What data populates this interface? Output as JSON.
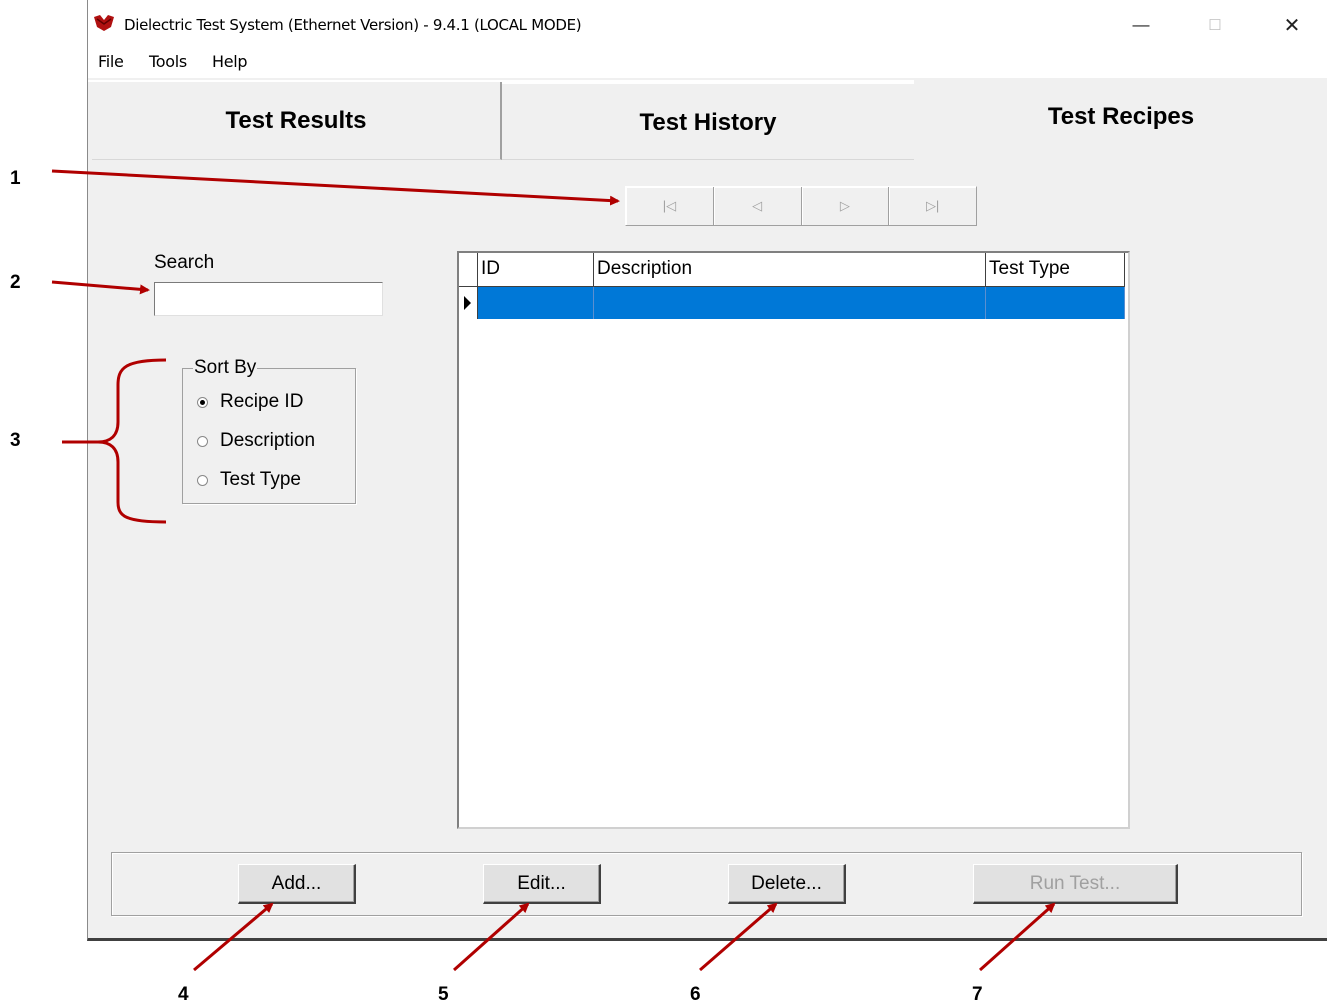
{
  "window": {
    "title": "Dielectric Test System (Ethernet Version) - 9.4.1  (LOCAL MODE)",
    "controls": {
      "minimize": "—",
      "maximize": "☐",
      "close": "✕"
    }
  },
  "menu": {
    "file": "File",
    "tools": "Tools",
    "help": "Help"
  },
  "tabs": [
    {
      "label": "Test Results"
    },
    {
      "label": "Test History"
    },
    {
      "label": "Test Recipes"
    }
  ],
  "nav_buttons": {
    "first": "|◁",
    "prev": "◁",
    "next": "▷",
    "last": "▷|"
  },
  "search": {
    "label": "Search",
    "value": ""
  },
  "sort": {
    "legend": "Sort By",
    "options": [
      {
        "label": "Recipe ID",
        "selected": true
      },
      {
        "label": "Description",
        "selected": false
      },
      {
        "label": "Test Type",
        "selected": false
      }
    ]
  },
  "grid": {
    "columns": [
      "ID",
      "Description",
      "Test Type"
    ]
  },
  "buttons": {
    "add": "Add...",
    "edit": "Edit...",
    "delete": "Delete...",
    "run_test": "Run Test..."
  },
  "callouts": [
    "1",
    "2",
    "3",
    "4",
    "5",
    "6",
    "7"
  ],
  "colors": {
    "selection": "#0078d7",
    "arrow": "#b00000",
    "window_bg": "#f0f0f0"
  }
}
